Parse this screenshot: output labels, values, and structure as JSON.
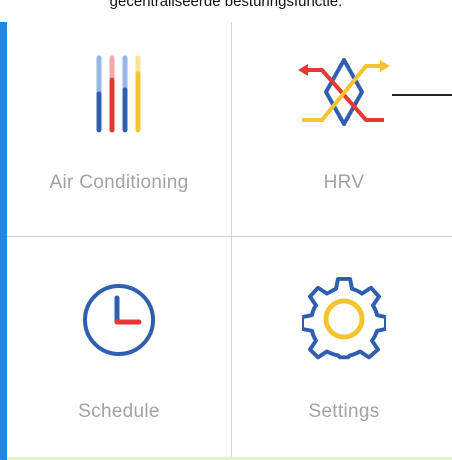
{
  "caption": "gecentraliseerde besturingsfunctie.",
  "tiles": {
    "air_conditioning": {
      "label": "Air Conditioning",
      "icon": "air-conditioning-sliders-icon"
    },
    "hrv": {
      "label": "HRV",
      "icon": "hrv-heat-exchange-icon"
    },
    "schedule": {
      "label": "Schedule",
      "icon": "clock-icon"
    },
    "settings": {
      "label": "Settings",
      "icon": "gear-icon"
    }
  },
  "colors": {
    "left_bar": "#1e88e5",
    "bottom_line": "#e3f2c9",
    "blue": "#2f5fae",
    "red": "#e53935",
    "yellow": "#f4c430",
    "light_blue": "#9ab6e6",
    "light_red": "#f3a9a9",
    "light_yellow": "#f8e49a",
    "label": "#a3a3a3"
  }
}
